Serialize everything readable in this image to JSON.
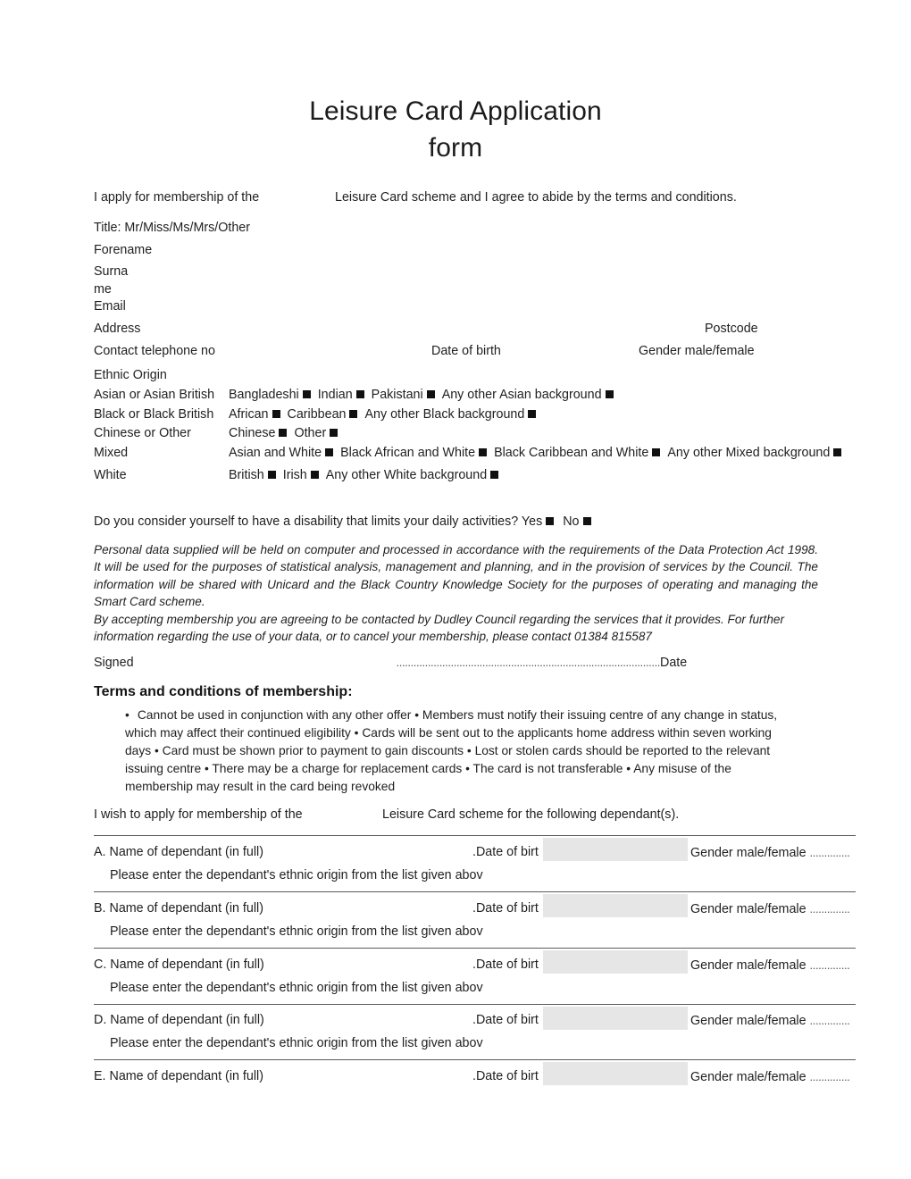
{
  "document": {
    "title_line1": "Leisure Card Application",
    "title_line2": "form"
  },
  "intro": {
    "left": "I apply for membership of the",
    "right": "Leisure Card scheme and I agree to abide by the terms and conditions."
  },
  "personal_fields": {
    "title": "Title: Mr/Miss/Ms/Mrs/Other",
    "forename": "Forename",
    "surname_part1": "Surna",
    "surname_part2": "me",
    "email": "Email",
    "address": "Address",
    "postcode": "Postcode",
    "contact_telephone": "Contact telephone no",
    "date_of_birth": "Date of birth",
    "gender": "Gender male/female"
  },
  "ethnic_origin": {
    "heading": "Ethnic Origin",
    "rows": [
      {
        "category": "Asian or Asian British",
        "options": [
          "Bangladeshi",
          "Indian",
          "Pakistani",
          "Any other Asian background"
        ]
      },
      {
        "category": "Black or Black British",
        "options": [
          "African",
          "Caribbean",
          "Any other Black background"
        ]
      },
      {
        "category": "Chinese or Other",
        "options": [
          "Chinese",
          "Other"
        ]
      },
      {
        "category": "Mixed",
        "options": [
          "Asian and White",
          "Black African and White",
          "Black Caribbean and White",
          "Any other Mixed background"
        ]
      },
      {
        "category": "White",
        "options": [
          "British",
          "Irish",
          "Any other White background"
        ]
      }
    ]
  },
  "disability": {
    "question": "Do you consider yourself to have a disability that limits your daily activities?",
    "yes_label": "Yes",
    "no_label": "No"
  },
  "privacy": {
    "paragraph1": "Personal data supplied will be held on computer and processed in accordance with the requirements of the Data Protection Act 1998. It will be used for the purposes of statistical analysis, management and planning, and in the provision of services by the Council. The information will be shared with Unicard and the Black Country Knowledge Society for the purposes of operating and managing the Smart Card scheme.",
    "paragraph2": "By accepting membership you are agreeing to be contacted by Dudley Council regarding the services that it provides. For further information regarding the use of your data, or to cancel your membership, please contact 01384 815587"
  },
  "signature": {
    "signed_label": "Signed",
    "leader": "............................................................................................",
    "date_label": "Date"
  },
  "terms": {
    "heading": "Terms and conditions of membership:",
    "bullet": "•",
    "body": "Cannot be used in conjunction with any other offer • Members must notify their issuing centre of any change in status, which may affect their continued eligibility • Cards will be sent out to the applicants home address within seven working days • Card must be shown prior to payment to gain discounts • Lost or stolen cards should be reported to the relevant issuing centre • There may be a charge for replacement cards • The card is not transferable • Any misuse of the membership may result in the card being revoked"
  },
  "dependants": {
    "intro_left": "I wish to apply for membership of the",
    "intro_right": "Leisure Card scheme for the following dependant(s).",
    "name_label": "Name of dependant (in full)",
    "dob_label": ".Date of birt",
    "gender_label": "Gender  male/female",
    "gender_leader": "..............",
    "sub_label": "Please enter the dependant's ethnic origin from the list given abov",
    "rows": [
      {
        "letter": "A.",
        "has_sub": true
      },
      {
        "letter": "B.",
        "has_sub": true
      },
      {
        "letter": "C.",
        "has_sub": true
      },
      {
        "letter": "D.",
        "has_sub": true
      },
      {
        "letter": "E.",
        "has_sub": false
      }
    ]
  },
  "colors": {
    "text": "#1f1f1f",
    "rule": "#5a5a5a",
    "shade": "#e6e6e6",
    "checkbox": "#111111"
  }
}
